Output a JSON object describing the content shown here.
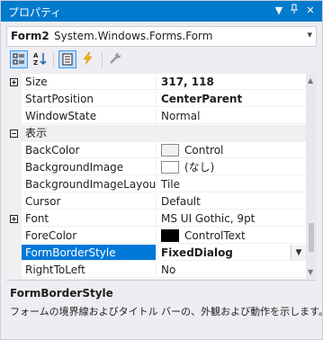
{
  "window": {
    "title": "プロパティ",
    "dropdown_icon": "chevron-down-icon",
    "pin_icon": "pin-icon",
    "close_icon": "close-icon"
  },
  "object_selector": {
    "name": "Form2",
    "type": "System.Windows.Forms.Form"
  },
  "toolbar": {
    "buttons": [
      {
        "icon": "categorized-icon",
        "active": true
      },
      {
        "icon": "alphabetical-sort-icon",
        "active": false
      },
      {
        "icon": "properties-icon",
        "active": true
      },
      {
        "icon": "events-lightning-icon",
        "active": false
      },
      {
        "icon": "property-pages-wrench-icon",
        "active": false
      }
    ]
  },
  "grid": {
    "rows": [
      {
        "name": "Size",
        "value": "317, 118",
        "expander": "plus",
        "bold": true
      },
      {
        "name": "StartPosition",
        "value": "CenterParent",
        "bold": true
      },
      {
        "name": "WindowState",
        "value": "Normal"
      },
      {
        "category": "表示",
        "expander": "minus"
      },
      {
        "name": "BackColor",
        "value": "Control",
        "swatch": "#f0f0f0"
      },
      {
        "name": "BackgroundImage",
        "value": "(なし)",
        "swatch": "#ffffff"
      },
      {
        "name": "BackgroundImageLayout",
        "value": "Tile"
      },
      {
        "name": "Cursor",
        "value": "Default"
      },
      {
        "name": "Font",
        "value": "MS UI Gothic, 9pt",
        "expander": "plus"
      },
      {
        "name": "ForeColor",
        "value": "ControlText",
        "swatch": "#000000"
      },
      {
        "name": "FormBorderStyle",
        "value": "FixedDialog",
        "selected": true,
        "bold": true
      },
      {
        "name": "RightToLeft",
        "value": "No"
      }
    ]
  },
  "description": {
    "title": "FormBorderStyle",
    "text": "フォームの境界線およびタイトル バーの、外観および動作を示します。"
  },
  "colors": {
    "accent": "#007acc",
    "selection": "#0078d7"
  }
}
